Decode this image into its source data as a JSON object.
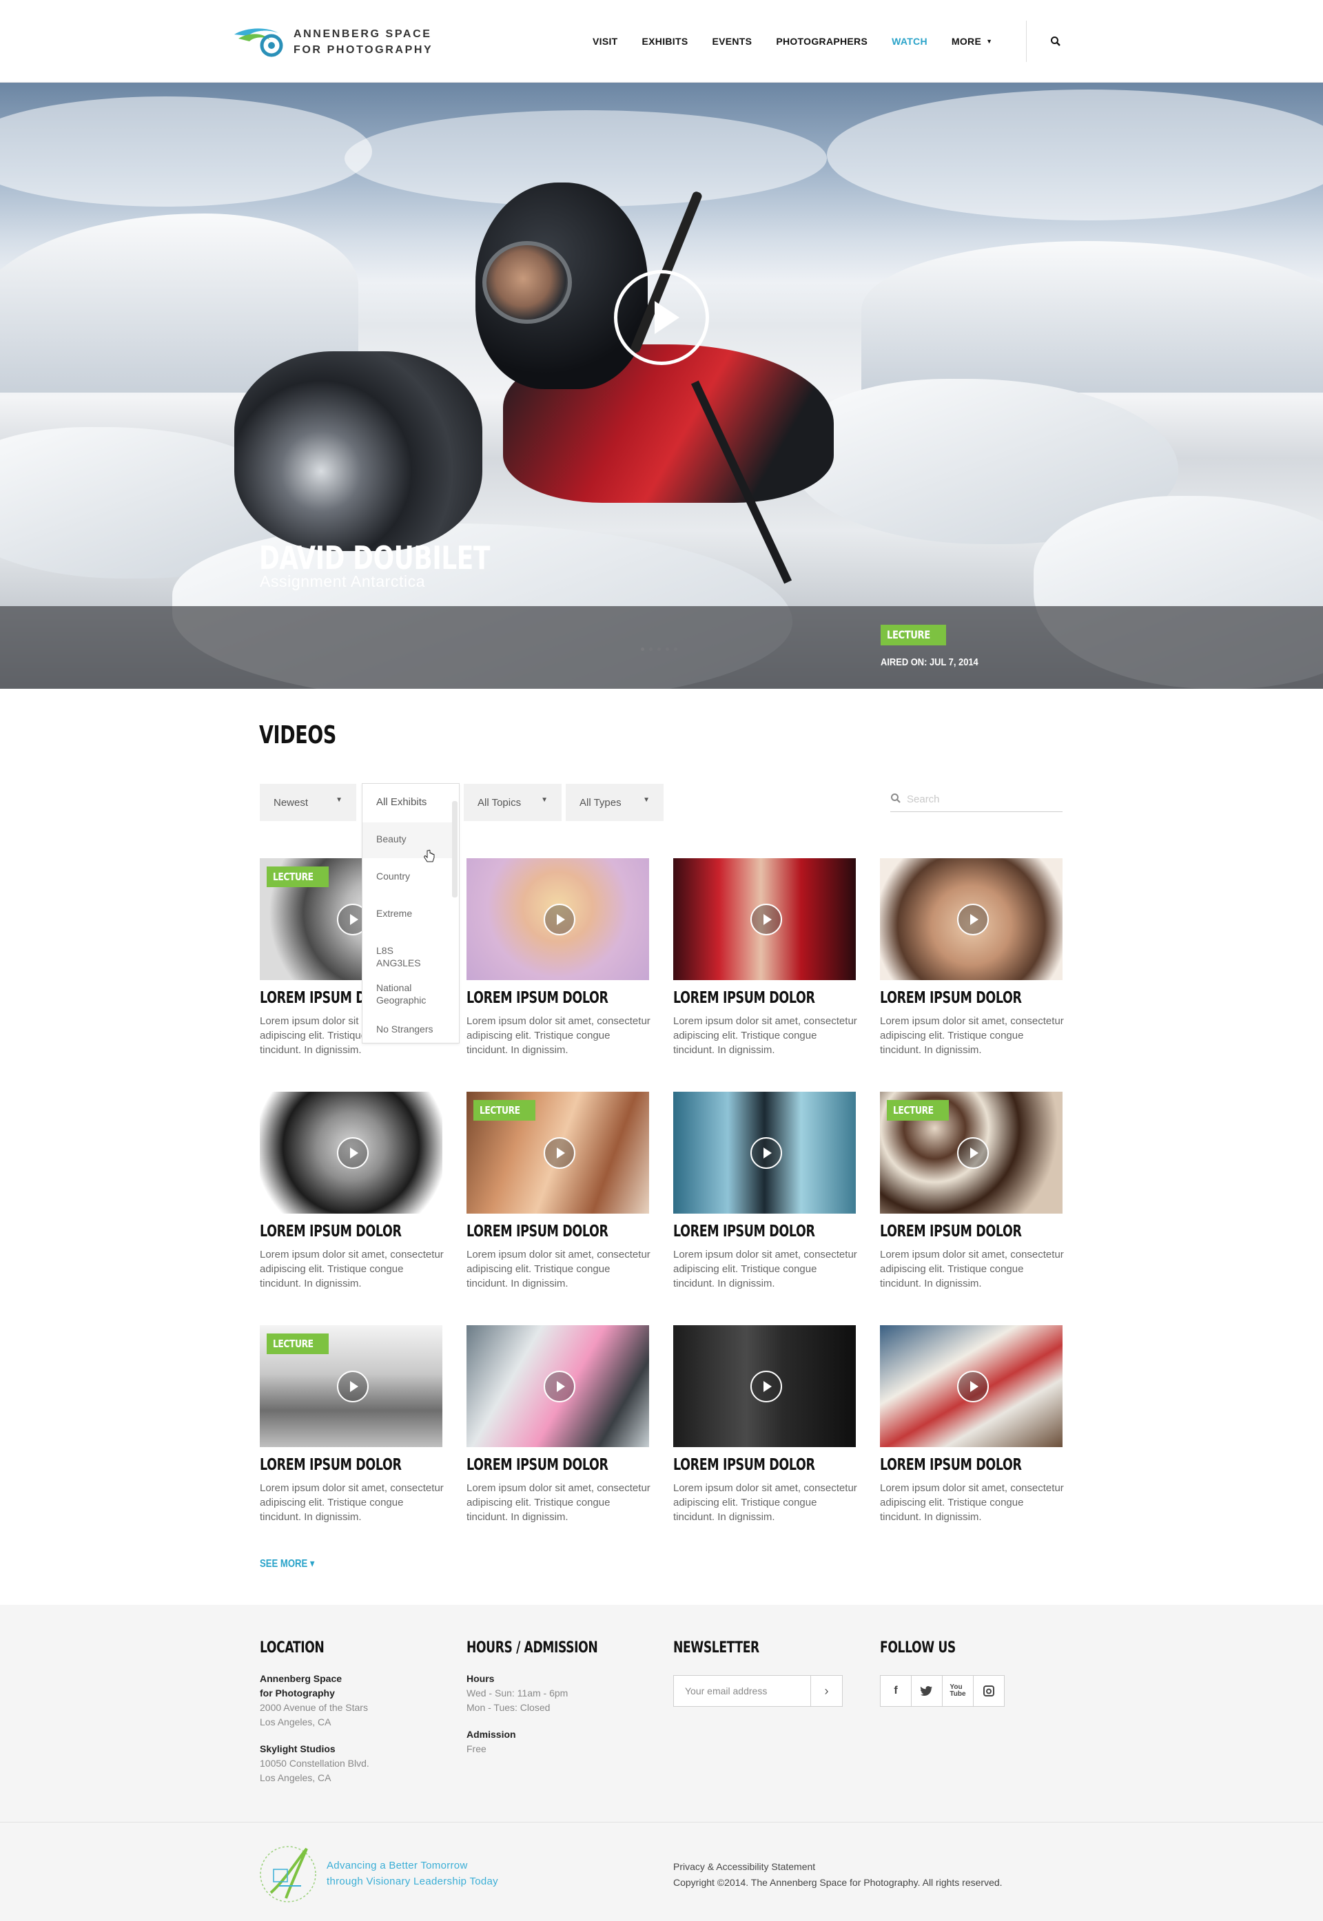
{
  "brand": {
    "line1": "ANNENBERG SPACE",
    "line2": "FOR PHOTOGRAPHY"
  },
  "nav": [
    {
      "label": "VISIT"
    },
    {
      "label": "EXHIBITS"
    },
    {
      "label": "EVENTS"
    },
    {
      "label": "PHOTOGRAPHERS"
    },
    {
      "label": "WATCH",
      "active": true
    },
    {
      "label": "MORE",
      "has_dropdown": true
    }
  ],
  "hero": {
    "title": "DAVID DOUBILET",
    "subtitle": "Assignment Antarctica",
    "badge": "LECTURE",
    "aired": "AIRED ON: JUL 7, 2014",
    "slide_count": 5,
    "active_slide": 1
  },
  "videos": {
    "heading": "VIDEOS",
    "filters": {
      "sort": "Newest",
      "exhibits": "All Exhibits",
      "topics": "All Topics",
      "types": "All Types"
    },
    "exhibits_dropdown": [
      "Beauty",
      "Country",
      "Extreme",
      "L8S ANG3LES",
      "National Geographic",
      "No Strangers"
    ],
    "search_placeholder": "Search",
    "items": [
      {
        "title": "LOREM IPSUM DOLOR",
        "desc": "Lorem ipsum dolor sit amet, consectetur adipiscing elit. Tristique congue tincidunt. In dignissim.",
        "badge": "LECTURE"
      },
      {
        "title": "LOREM IPSUM DOLOR",
        "desc": "Lorem ipsum dolor sit amet, consectetur adipiscing elit. Tristique congue tincidunt. In dignissim.",
        "badge": ""
      },
      {
        "title": "LOREM IPSUM DOLOR",
        "desc": "Lorem ipsum dolor sit amet, consectetur adipiscing elit. Tristique congue tincidunt. In dignissim.",
        "badge": ""
      },
      {
        "title": "LOREM IPSUM DOLOR",
        "desc": "Lorem ipsum dolor sit amet, consectetur adipiscing elit. Tristique congue tincidunt. In dignissim.",
        "badge": ""
      },
      {
        "title": "LOREM IPSUM DOLOR",
        "desc": "Lorem ipsum dolor sit amet, consectetur adipiscing elit. Tristique congue tincidunt. In dignissim.",
        "badge": ""
      },
      {
        "title": "LOREM IPSUM DOLOR",
        "desc": "Lorem ipsum dolor sit amet, consectetur adipiscing elit. Tristique congue tincidunt. In dignissim.",
        "badge": "LECTURE"
      },
      {
        "title": "LOREM IPSUM DOLOR",
        "desc": "Lorem ipsum dolor sit amet, consectetur adipiscing elit. Tristique congue tincidunt. In dignissim.",
        "badge": ""
      },
      {
        "title": "LOREM IPSUM DOLOR",
        "desc": "Lorem ipsum dolor sit amet, consectetur adipiscing elit. Tristique congue tincidunt. In dignissim.",
        "badge": "LECTURE"
      },
      {
        "title": "LOREM IPSUM DOLOR",
        "desc": "Lorem ipsum dolor sit amet, consectetur adipiscing elit. Tristique congue tincidunt. In dignissim.",
        "badge": "LECTURE"
      },
      {
        "title": "LOREM IPSUM DOLOR",
        "desc": "Lorem ipsum dolor sit amet, consectetur adipiscing elit. Tristique congue tincidunt. In dignissim.",
        "badge": ""
      },
      {
        "title": "LOREM IPSUM DOLOR",
        "desc": "Lorem ipsum dolor sit amet, consectetur adipiscing elit. Tristique congue tincidunt. In dignissim.",
        "badge": ""
      },
      {
        "title": "LOREM IPSUM DOLOR",
        "desc": "Lorem ipsum dolor sit amet, consectetur adipiscing elit. Tristique congue tincidunt. In dignissim.",
        "badge": ""
      }
    ],
    "see_more": "SEE MORE"
  },
  "footer": {
    "location": {
      "heading": "LOCATION",
      "venue1_name_line1": "Annenberg Space",
      "venue1_name_line2": "for Photography",
      "venue1_addr1": "2000 Avenue of the Stars",
      "venue1_addr2": "Los Angeles, CA",
      "venue2_name": "Skylight Studios",
      "venue2_addr1": "10050 Constellation Blvd.",
      "venue2_addr2": "Los Angeles, CA"
    },
    "hours": {
      "heading": "HOURS / ADMISSION",
      "hours_label": "Hours",
      "hours_line1": "Wed - Sun: 11am - 6pm",
      "hours_line2": "Mon - Tues: Closed",
      "admission_label": "Admission",
      "admission_value": "Free"
    },
    "newsletter": {
      "heading": "NEWSLETTER",
      "placeholder": "Your email address",
      "submit": "›"
    },
    "follow": {
      "heading": "FOLLOW US",
      "icons": [
        "facebook-icon",
        "twitter-icon",
        "youtube-icon",
        "instagram-icon"
      ]
    },
    "tagline_line1": "Advancing a Better Tomorrow",
    "tagline_line2": "through Visionary Leadership Today",
    "privacy": "Privacy & Accessibility Statement",
    "copyright": "Copyright ©2014. The Annenberg Space for Photography. All rights reserved."
  },
  "colors": {
    "accent": "#2aa3c9",
    "badge": "#7dc241"
  }
}
